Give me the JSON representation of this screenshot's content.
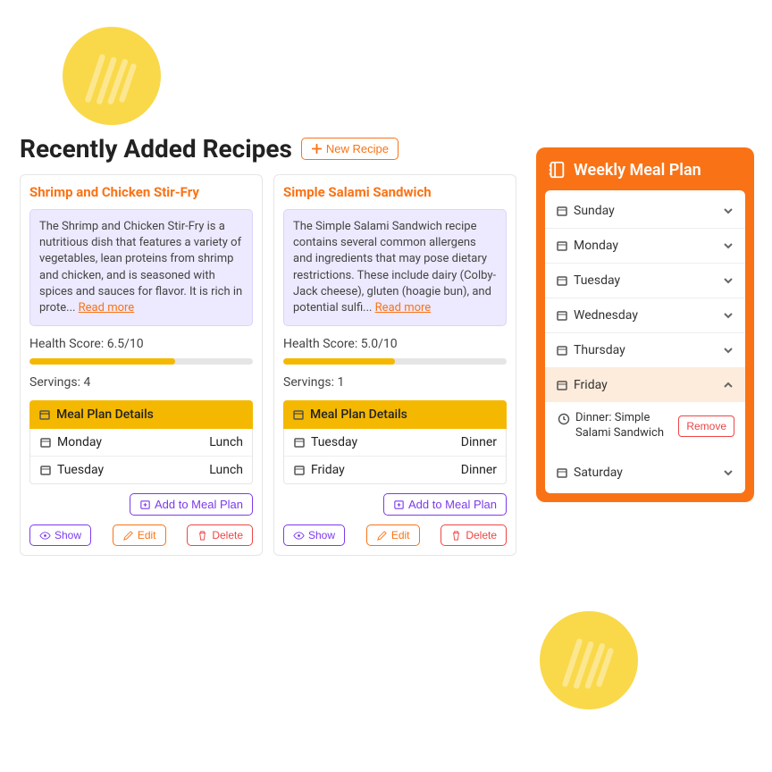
{
  "header": {
    "title": "Recently Added Recipes",
    "newRecipe": "New Recipe"
  },
  "readMore": "Read more",
  "addToMealPlan": "Add to Meal Plan",
  "mealPlanDetails": "Meal Plan Details",
  "buttons": {
    "show": "Show",
    "edit": "Edit",
    "delete": "Delete"
  },
  "recipes": [
    {
      "title": "Shrimp and Chicken Stir-Fry",
      "desc": "The Shrimp and Chicken Stir-Fry is a nutritious dish that features a variety of vegetables, lean proteins from shrimp and chicken, and is seasoned with spices and sauces for flavor. It is rich in prote... ",
      "healthScore": "Health Score: 6.5/10",
      "progress": 65,
      "servings": "Servings: 4",
      "plan": [
        {
          "day": "Monday",
          "meal": "Lunch"
        },
        {
          "day": "Tuesday",
          "meal": "Lunch"
        }
      ]
    },
    {
      "title": "Simple Salami Sandwich",
      "desc": "The Simple Salami Sandwich recipe contains several common allergens and ingredients that may pose dietary restrictions. These include dairy (Colby-Jack cheese), gluten (hoagie bun), and potential sulfi... ",
      "healthScore": "Health Score: 5.0/10",
      "progress": 50,
      "servings": "Servings: 1",
      "plan": [
        {
          "day": "Tuesday",
          "meal": "Dinner"
        },
        {
          "day": "Friday",
          "meal": "Dinner"
        }
      ]
    }
  ],
  "weekly": {
    "title": "Weekly Meal Plan",
    "days": [
      "Sunday",
      "Monday",
      "Tuesday",
      "Wednesday",
      "Thursday",
      "Friday",
      "Saturday"
    ],
    "fridayMeal": "Dinner: Simple Salami Sandwich",
    "remove": "Remove"
  }
}
